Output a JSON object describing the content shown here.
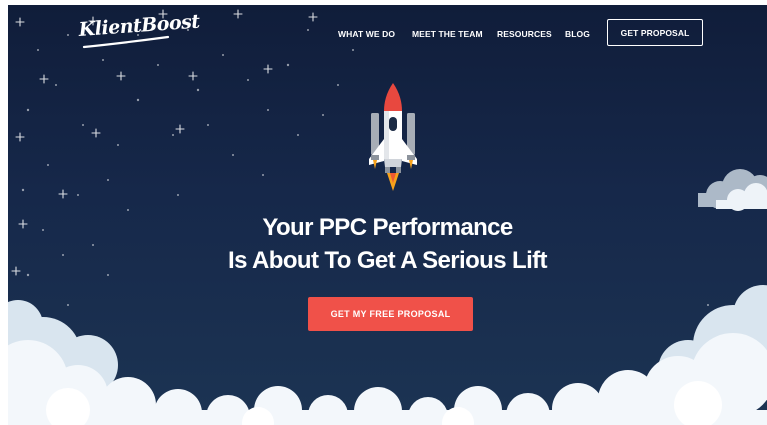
{
  "brand": {
    "logo_text": "KlientBoost"
  },
  "nav": {
    "items": [
      {
        "label": "WHAT WE DO"
      },
      {
        "label": "MEET THE TEAM"
      },
      {
        "label": "RESOURCES"
      },
      {
        "label": "BLOG"
      }
    ],
    "cta_label": "GET PROPOSAL"
  },
  "hero": {
    "headline_line1": "Your PPC Performance",
    "headline_line2": "Is About To Get A Serious Lift",
    "cta_label": "GET MY FREE PROPOSAL"
  },
  "illustration": {
    "main": "rocket-icon",
    "decor": [
      "star-icon",
      "cloud-icon"
    ]
  },
  "colors": {
    "sky_top": "#101d3a",
    "sky_bottom": "#1c3453",
    "cta": "#f05149",
    "rocket_nose": "#e8483f",
    "cloud": "#e8f1f8"
  }
}
